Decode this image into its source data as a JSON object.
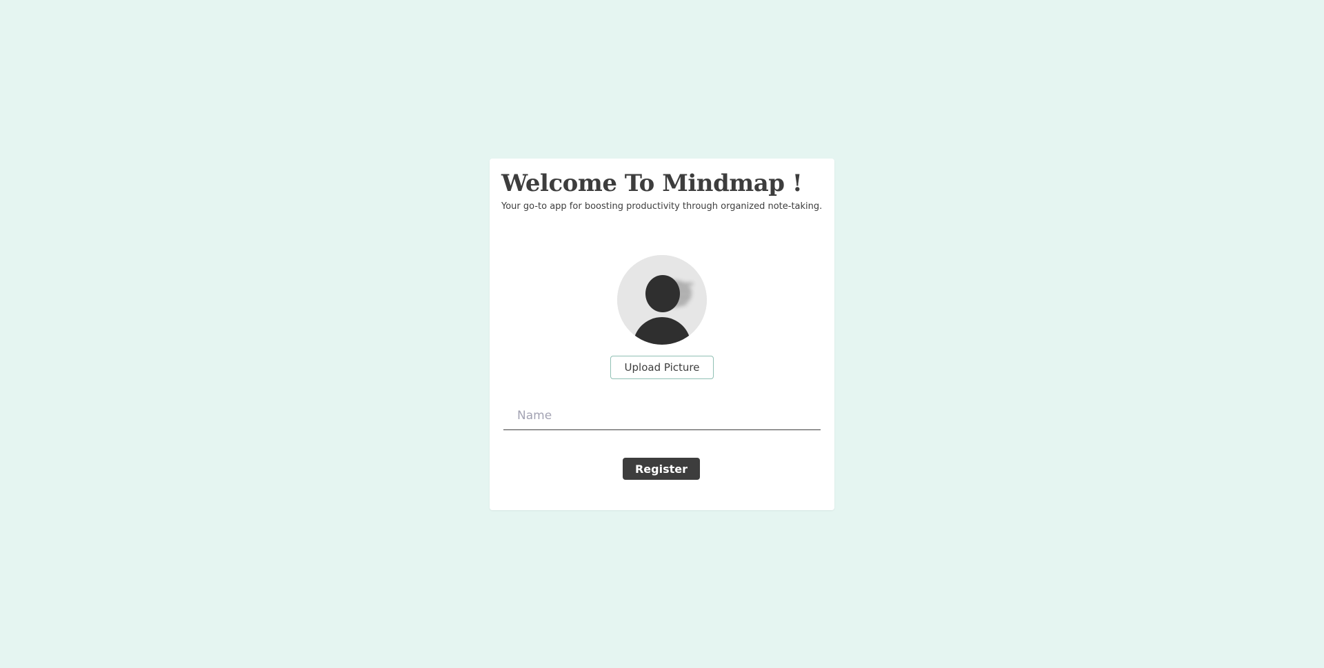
{
  "welcome": {
    "title": "Welcome To Mindmap !",
    "subtitle": "Your go-to app for boosting productivity through organized note-taking."
  },
  "avatar": {
    "icon": "default-user-avatar",
    "background": "#e6e6e6",
    "figure_color": "#2f2f2f"
  },
  "upload": {
    "label": "Upload Picture"
  },
  "name_input": {
    "placeholder": "Name",
    "value": ""
  },
  "register": {
    "label": "Register"
  },
  "colors": {
    "page_background": "#e5f5f1",
    "card_background": "#ffffff",
    "text": "#3d3d3d",
    "button_dark": "#3d3d3d",
    "upload_border": "#8fbfb3"
  }
}
